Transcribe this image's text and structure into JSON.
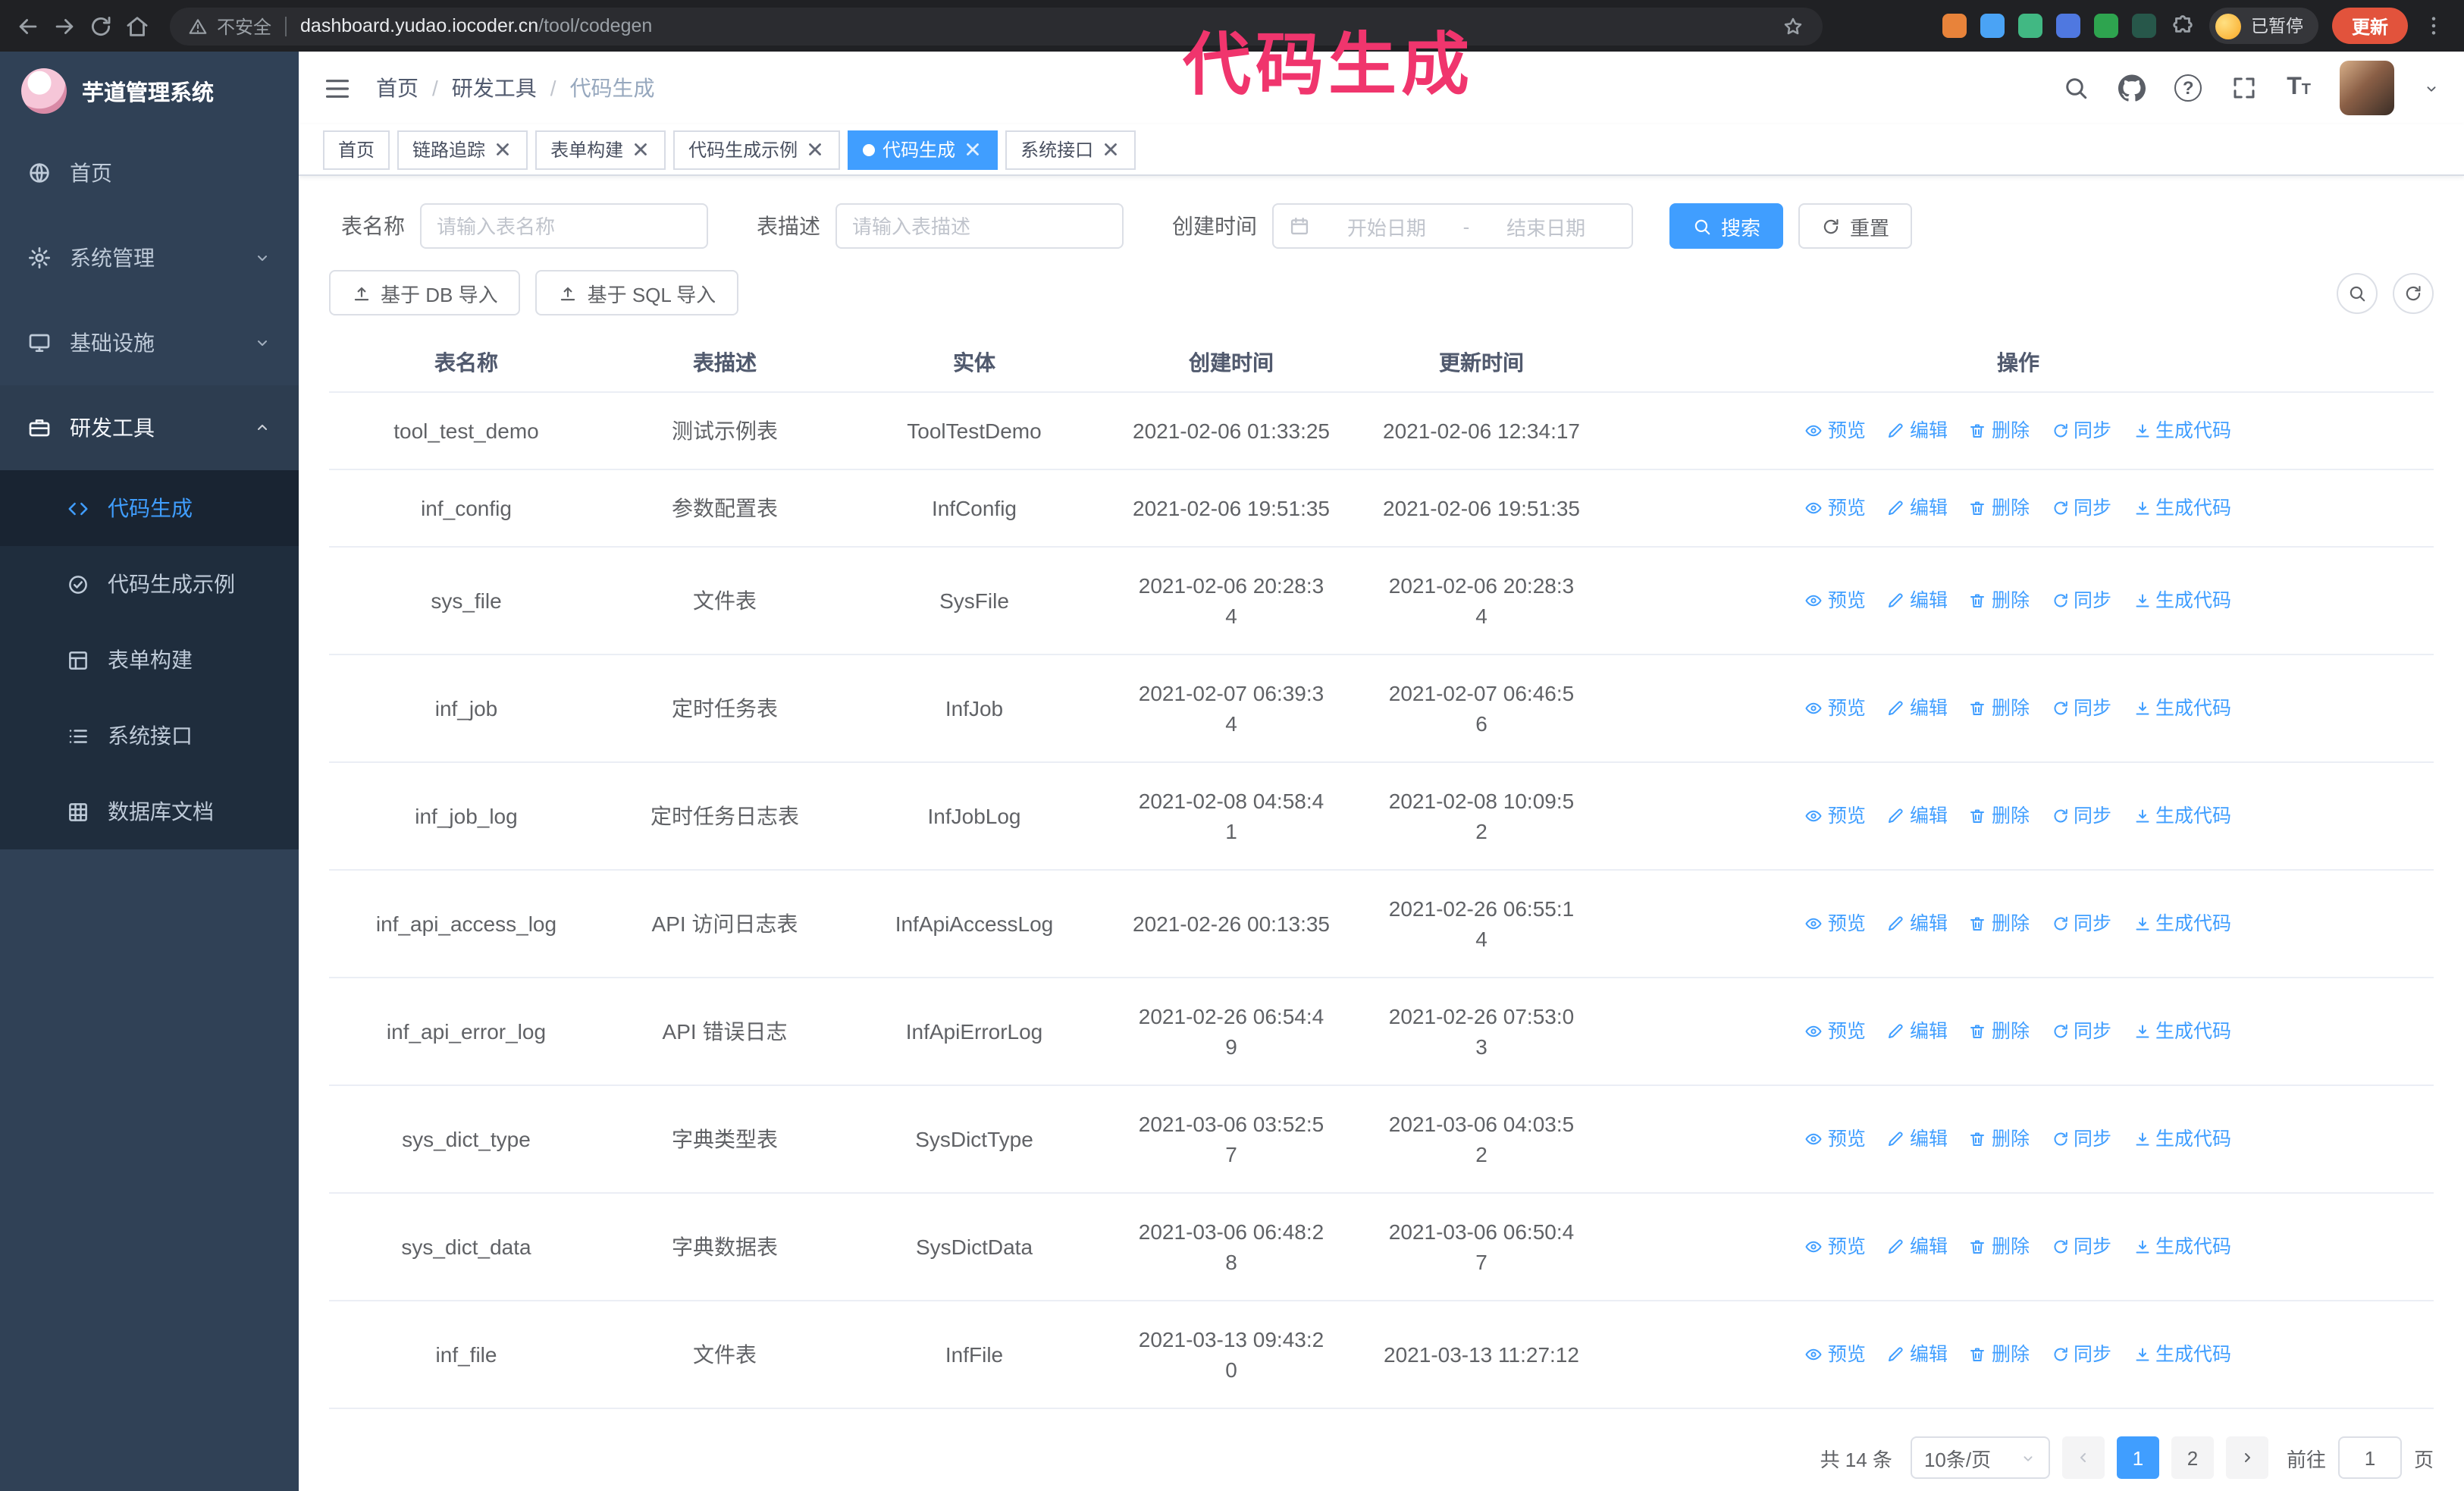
{
  "colors": {
    "accent": "#409eff",
    "sidebar_bg": "#304156",
    "submenu_bg": "#1f2d3d",
    "annotation": "#f0356d",
    "update_button": "#e2533c"
  },
  "annotation": {
    "title": "代码生成"
  },
  "browser": {
    "security_label": "不安全",
    "url_domain": "dashboard.yudao.iocoder.cn",
    "url_path": "/tool/codegen",
    "paused_badge": "已暂停",
    "update_button": "更新",
    "extensions": [
      {
        "name": "orange-extension-icon",
        "color": "#e8833a"
      },
      {
        "name": "blue-drop-extension-icon",
        "color": "#4aa3f5"
      },
      {
        "name": "vue-devtools-icon",
        "color": "#41b883"
      },
      {
        "name": "people-extension-icon",
        "color": "#4f78e0"
      },
      {
        "name": "green-extension-icon",
        "color": "#2ea44f"
      },
      {
        "name": "leaf-extension-icon",
        "color": "#27574a"
      }
    ]
  },
  "sidebar": {
    "app_title": "芋道管理系统",
    "items": [
      {
        "key": "home",
        "label": "首页",
        "icon": "dashboard-icon",
        "expandable": false,
        "expanded": false
      },
      {
        "key": "system",
        "label": "系统管理",
        "icon": "gear-icon",
        "expandable": true,
        "expanded": false
      },
      {
        "key": "infra",
        "label": "基础设施",
        "icon": "monitor-icon",
        "expandable": true,
        "expanded": false
      },
      {
        "key": "dev-tools",
        "label": "研发工具",
        "icon": "toolbox-icon",
        "expandable": true,
        "expanded": true
      }
    ],
    "submenu": [
      {
        "key": "codegen",
        "label": "代码生成",
        "icon": "code-icon",
        "active": true
      },
      {
        "key": "codegen-example",
        "label": "代码生成示例",
        "icon": "circle-check-icon",
        "active": false
      },
      {
        "key": "form-builder",
        "label": "表单构建",
        "icon": "form-icon",
        "active": false
      },
      {
        "key": "api-doc",
        "label": "系统接口",
        "icon": "list-icon",
        "active": false
      },
      {
        "key": "db-doc",
        "label": "数据库文档",
        "icon": "grid-icon",
        "active": false
      }
    ]
  },
  "breadcrumb": [
    "首页",
    "研发工具",
    "代码生成"
  ],
  "breadcrumb_separator": "/",
  "tabs": [
    {
      "key": "home",
      "label": "首页",
      "closable": false,
      "active": false
    },
    {
      "key": "tracer",
      "label": "链路追踪",
      "closable": true,
      "active": false
    },
    {
      "key": "form-builder",
      "label": "表单构建",
      "closable": true,
      "active": false
    },
    {
      "key": "codegen-example",
      "label": "代码生成示例",
      "closable": true,
      "active": false
    },
    {
      "key": "codegen",
      "label": "代码生成",
      "closable": true,
      "active": true
    },
    {
      "key": "api-doc",
      "label": "系统接口",
      "closable": true,
      "active": false
    }
  ],
  "filters": {
    "table_name_label": "表名称",
    "table_name_placeholder": "请输入表名称",
    "table_desc_label": "表描述",
    "table_desc_placeholder": "请输入表描述",
    "create_time_label": "创建时间",
    "date_start_placeholder": "开始日期",
    "date_separator": "-",
    "date_end_placeholder": "结束日期",
    "search_button": "搜索",
    "reset_button": "重置"
  },
  "toolbar": {
    "import_db": "基于 DB 导入",
    "import_sql": "基于 SQL 导入"
  },
  "table": {
    "columns": [
      "表名称",
      "表描述",
      "实体",
      "创建时间",
      "更新时间",
      "操作"
    ],
    "actions": [
      "预览",
      "编辑",
      "删除",
      "同步",
      "生成代码"
    ],
    "rows": [
      {
        "name": "tool_test_demo",
        "desc": "测试示例表",
        "entity": "ToolTestDemo",
        "created": "2021-02-06 01:33:25",
        "updated": "2021-02-06 12:34:17"
      },
      {
        "name": "inf_config",
        "desc": "参数配置表",
        "entity": "InfConfig",
        "created": "2021-02-06 19:51:35",
        "updated": "2021-02-06 19:51:35"
      },
      {
        "name": "sys_file",
        "desc": "文件表",
        "entity": "SysFile",
        "created": "2021-02-06 20:28:3\n4",
        "updated": "2021-02-06 20:28:3\n4"
      },
      {
        "name": "inf_job",
        "desc": "定时任务表",
        "entity": "InfJob",
        "created": "2021-02-07 06:39:3\n4",
        "updated": "2021-02-07 06:46:5\n6"
      },
      {
        "name": "inf_job_log",
        "desc": "定时任务日志表",
        "entity": "InfJobLog",
        "created": "2021-02-08 04:58:4\n1",
        "updated": "2021-02-08 10:09:5\n2"
      },
      {
        "name": "inf_api_access_log",
        "desc": "API 访问日志表",
        "entity": "InfApiAccessLog",
        "created": "2021-02-26 00:13:35",
        "updated": "2021-02-26 06:55:1\n4"
      },
      {
        "name": "inf_api_error_log",
        "desc": "API 错误日志",
        "entity": "InfApiErrorLog",
        "created": "2021-02-26 06:54:4\n9",
        "updated": "2021-02-26 07:53:0\n3"
      },
      {
        "name": "sys_dict_type",
        "desc": "字典类型表",
        "entity": "SysDictType",
        "created": "2021-03-06 03:52:5\n7",
        "updated": "2021-03-06 04:03:5\n2"
      },
      {
        "name": "sys_dict_data",
        "desc": "字典数据表",
        "entity": "SysDictData",
        "created": "2021-03-06 06:48:2\n8",
        "updated": "2021-03-06 06:50:4\n7"
      },
      {
        "name": "inf_file",
        "desc": "文件表",
        "entity": "InfFile",
        "created": "2021-03-13 09:43:2\n0",
        "updated": "2021-03-13 11:27:12"
      }
    ]
  },
  "pagination": {
    "total": "共 14 条",
    "page_size": "10条/页",
    "pages": [
      "1",
      "2"
    ],
    "active_page": "1",
    "goto_label": "前往",
    "goto_value": "1",
    "goto_suffix": "页"
  }
}
